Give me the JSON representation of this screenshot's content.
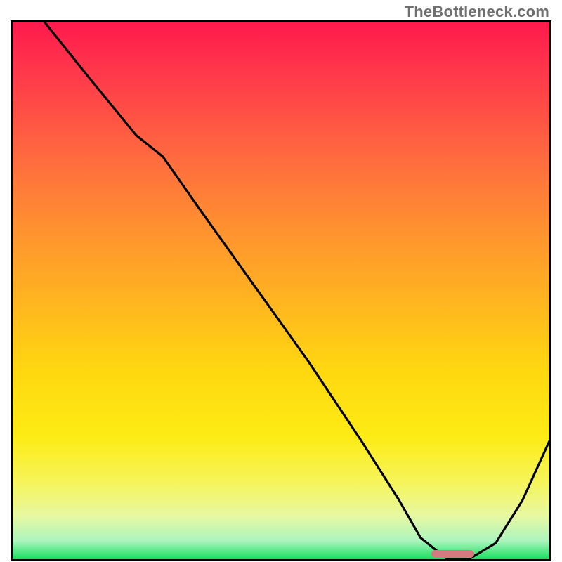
{
  "watermark": "TheBottleneck.com",
  "colors": {
    "gradient_top": "#ff1a4d",
    "gradient_mid": "#ffd810",
    "gradient_bottom": "#18e060",
    "curve": "#000000",
    "border": "#000000",
    "trough_band": "#d57b7f"
  },
  "chart_data": {
    "type": "line",
    "title": "",
    "xlabel": "",
    "ylabel": "",
    "xlim": [
      0,
      100
    ],
    "ylim": [
      0,
      100
    ],
    "grid": false,
    "notes": "No axis ticks or labels are shown. y values estimated from vertical position (0 = bottom band / optimal, 100 = top). x is horizontal position as percent of plot width.",
    "series": [
      {
        "name": "curve",
        "x": [
          6,
          14,
          23,
          28,
          35,
          45,
          55,
          65,
          72,
          76,
          81,
          85,
          90,
          95,
          100
        ],
        "y": [
          100,
          90,
          79,
          75,
          65,
          51,
          37,
          22,
          11,
          4,
          0,
          0,
          3,
          11,
          22
        ]
      }
    ],
    "flat_min_range_x": [
      78,
      86
    ],
    "trough_marker": {
      "x_start": 78,
      "x_end": 86,
      "y": 0
    }
  }
}
